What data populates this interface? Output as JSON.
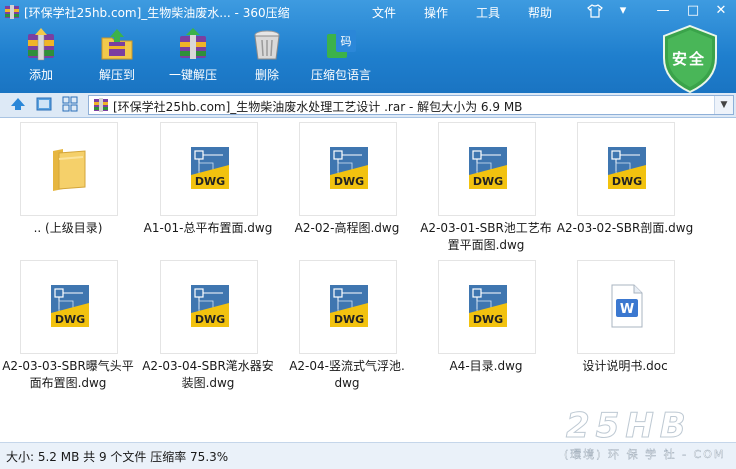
{
  "window": {
    "title": "[环保学社25hb.com]_生物柴油废水... - 360压缩",
    "menu": [
      "文件",
      "操作",
      "工具",
      "帮助"
    ],
    "controls": [
      "▾",
      "—",
      "□",
      "✕"
    ]
  },
  "toolbar": {
    "buttons": [
      {
        "label": "添加",
        "icon": "add-archive-icon"
      },
      {
        "label": "解压到",
        "icon": "extract-to-icon"
      },
      {
        "label": "一键解压",
        "icon": "one-click-extract-icon"
      },
      {
        "label": "删除",
        "icon": "delete-trash-icon"
      },
      {
        "label": "压缩包语言",
        "icon": "archive-language-icon"
      }
    ],
    "security_label": "安全"
  },
  "address": {
    "path": "[环保学社25hb.com]_生物柴油废水处理工艺设计 .rar - 解包大小为 6.9 MB"
  },
  "files": [
    {
      "name_lines": [
        ".. (上级目录)"
      ],
      "type": "folder"
    },
    {
      "name_lines": [
        "A1-01-总平布置面.dwg"
      ],
      "type": "dwg"
    },
    {
      "name_lines": [
        "A2-02-高程图.dwg"
      ],
      "type": "dwg"
    },
    {
      "name_lines": [
        "A2-03-01-SBR池工艺布",
        "置平面图.dwg"
      ],
      "type": "dwg"
    },
    {
      "name_lines": [
        "A2-03-02-SBR剖面.dwg"
      ],
      "type": "dwg"
    },
    {
      "name_lines": [
        "A2-03-03-SBR曝气头平",
        "面布置图.dwg"
      ],
      "type": "dwg"
    },
    {
      "name_lines": [
        "A2-03-04-SBR滗水器安",
        "装图.dwg"
      ],
      "type": "dwg"
    },
    {
      "name_lines": [
        "A2-04-竖流式气浮池.",
        "dwg"
      ],
      "type": "dwg"
    },
    {
      "name_lines": [
        "A4-目录.dwg"
      ],
      "type": "dwg"
    },
    {
      "name_lines": [
        "设计说明书.doc"
      ],
      "type": "doc"
    }
  ],
  "dwg_badge": "DWG",
  "doc_badge": "W",
  "status": {
    "text": "大小: 5.2 MB 共 9 个文件 压缩率 75.3%"
  },
  "watermark": {
    "big": "25HB",
    "small": "(環境) 环 保 学 社 - COM"
  }
}
